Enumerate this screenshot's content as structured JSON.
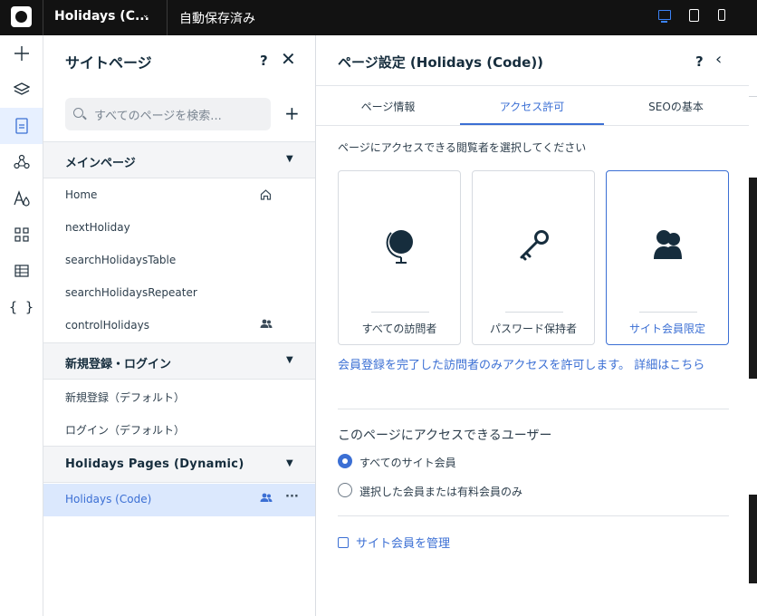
{
  "topbar": {
    "site_name": "Holidays (C...",
    "autosave": "自動保存済み"
  },
  "leftbar": {
    "icons": [
      "add-icon",
      "layers-icon",
      "pages-icon",
      "connections-icon",
      "theme-icon",
      "apps-icon",
      "table-icon",
      "code-icon"
    ]
  },
  "site_pages": {
    "title": "サイトページ",
    "help": "?",
    "search_placeholder": "すべてのページを検索...",
    "sections": [
      {
        "title": "メインページ",
        "items": [
          "Home",
          "nextHoliday",
          "searchHolidaysTable",
          "searchHolidaysRepeater",
          "controlHolidays"
        ]
      },
      {
        "title": "新規登録・ログイン",
        "items": [
          "新規登録（デフォルト）",
          "ログイン（デフォルト）"
        ]
      },
      {
        "title": "Holidays Pages (Dynamic)",
        "items": [
          "Holidays (Code)"
        ]
      }
    ],
    "more": "···"
  },
  "page_settings": {
    "title": "ページ設定 (Holidays (Code))",
    "help": "?",
    "tabs": [
      "ページ情報",
      "アクセス許可",
      "SEOの基本"
    ],
    "active_tab": "アクセス許可",
    "subtitle": "ページにアクセスできる閲覧者を選択してください",
    "options": [
      {
        "label": "すべての訪問者",
        "icon": "globe-icon"
      },
      {
        "label": "パスワード保持者",
        "icon": "key-icon"
      },
      {
        "label": "サイト会員限定",
        "icon": "members-icon",
        "selected": true
      }
    ],
    "info_text": "会員登録を完了した訪問者のみアクセスを許可します。",
    "info_link": "詳細はこちら",
    "who_title": "このページにアクセスできるユーザー",
    "radios": [
      {
        "label": "すべてのサイト会員",
        "checked": true
      },
      {
        "label": "選択した会員または有料会員のみ",
        "checked": false
      }
    ],
    "manage_link": "サイト会員を管理"
  },
  "colors": {
    "accent": "#3b6fd4",
    "topbar_bg": "#121212"
  }
}
